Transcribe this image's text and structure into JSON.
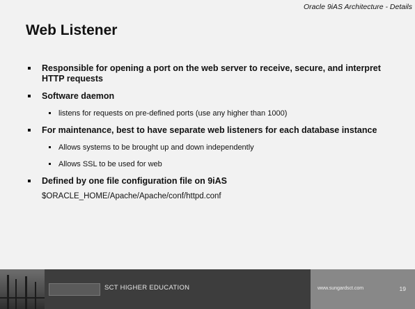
{
  "header": {
    "subtitle": "Oracle 9iAS Architecture - Details"
  },
  "slide": {
    "title": "Web Listener",
    "bullets": [
      {
        "text": "Responsible for opening a port on the web server to receive, secure, and interpret HTTP requests"
      },
      {
        "text": "Software daemon"
      },
      {
        "text": "listens for requests on pre-defined ports (use any higher than 1000)"
      },
      {
        "text": "For maintenance, best to have separate web listeners for each database instance"
      },
      {
        "text": "Allows systems to be brought up and down independently"
      },
      {
        "text": "Allows SSL to be used for web"
      },
      {
        "text": "Defined by one file configuration file on 9iAS"
      },
      {
        "text": "$ORACLE_HOME/Apache/Apache/conf/httpd.conf"
      }
    ]
  },
  "footer": {
    "org": "SCT HIGHER EDUCATION",
    "url": "www.sungardsct.com",
    "page": "19"
  }
}
